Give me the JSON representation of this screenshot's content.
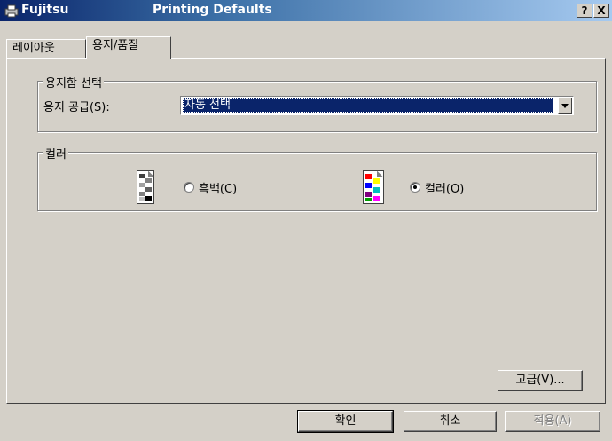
{
  "window": {
    "title_left": "Fujitsu",
    "title_main": "Printing Defaults",
    "help_button": "?",
    "close_button": "X"
  },
  "tabs": [
    {
      "label": "레이아웃",
      "active": false
    },
    {
      "label": "용지/품질",
      "active": true
    }
  ],
  "paper_source_group": {
    "legend": "용지함 선택",
    "label": "용지 공급(S):",
    "selected_value": "자동 선택"
  },
  "color_group": {
    "legend": "컬러",
    "options": [
      {
        "label": "흑백(C)",
        "selected": false
      },
      {
        "label": "컬러(O)",
        "selected": true
      }
    ]
  },
  "advanced_button": "고급(V)...",
  "footer": {
    "ok": "확인",
    "cancel": "취소",
    "apply": "적용(A)"
  },
  "colors": {
    "titlebar_start": "#0a246a",
    "titlebar_end": "#a6caf0",
    "face": "#d4d0c8",
    "selection": "#0a246a"
  }
}
